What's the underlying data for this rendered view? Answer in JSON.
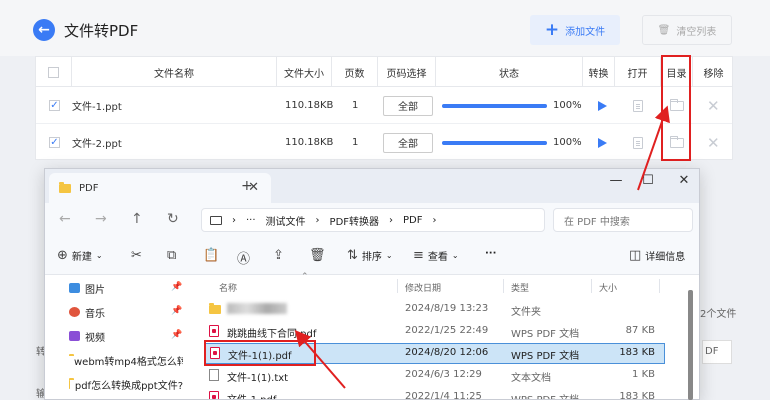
{
  "app": {
    "title": "文件转PDF",
    "add_file_label": "添加文件",
    "clear_label": "清空列表"
  },
  "table": {
    "headers": [
      "文件名称",
      "文件大小",
      "页数",
      "页码选择",
      "状态",
      "转换",
      "打开",
      "目录",
      "移除"
    ],
    "rows": [
      {
        "name": "文件-1.ppt",
        "size": "110.18KB",
        "pages": "1",
        "page_select": "全部",
        "progress": 1.0,
        "progress_label": "100%"
      },
      {
        "name": "文件-2.ppt",
        "size": "110.18KB",
        "pages": "1",
        "page_select": "全部",
        "progress": 1.0,
        "progress_label": "100%"
      }
    ]
  },
  "background_labels": {
    "left_1": "转",
    "left_2": "输",
    "right_1": "2个文件",
    "right_2": "DF"
  },
  "explorer": {
    "tab_title": "PDF",
    "breadcrumb": [
      "测试文件",
      "PDF转换器",
      "PDF"
    ],
    "breadcrumb_more": "···",
    "search_placeholder": "在 PDF 中搜索",
    "toolbar": {
      "new_label": "新建",
      "sort_label": "排序",
      "view_label": "查看",
      "more_label": "···",
      "details_label": "详细信息"
    },
    "nav_items": [
      {
        "label": "图片",
        "icon": "pictures-icon",
        "pinned": true
      },
      {
        "label": "音乐",
        "icon": "music-icon",
        "pinned": true
      },
      {
        "label": "视频",
        "icon": "video-icon",
        "pinned": true
      },
      {
        "label": "webm转mp4格式怎么转",
        "icon": "folder-icon",
        "pinned": false
      },
      {
        "label": "pdf怎么转换成ppt文件?",
        "icon": "folder-icon",
        "pinned": false
      }
    ],
    "columns": [
      "名称",
      "修改日期",
      "类型",
      "大小"
    ],
    "files": [
      {
        "name": "",
        "date": "2024/8/19 13:23",
        "type": "文件夹",
        "size": "",
        "icon": "folder-icon",
        "blurred": true
      },
      {
        "name": "跳跳曲线下合同.pdf",
        "date": "2022/1/25 22:49",
        "type": "WPS PDF 文档",
        "size": "87 KB",
        "icon": "pdf-icon"
      },
      {
        "name": "文件-1(1).pdf",
        "date": "2024/8/20 12:06",
        "type": "WPS PDF 文档",
        "size": "183 KB",
        "icon": "pdf-icon",
        "selected": true
      },
      {
        "name": "文件-1(1).txt",
        "date": "2024/6/3 12:29",
        "type": "文本文档",
        "size": "1 KB",
        "icon": "txt-icon"
      },
      {
        "name": "文件-1.pdf",
        "date": "2022/1/4 11:25",
        "type": "WPS PDF 文档",
        "size": "183 KB",
        "icon": "pdf-icon"
      }
    ]
  },
  "colors": {
    "accent": "#3a7bf5",
    "highlight_red": "#e02020",
    "selection": "#cce4f7"
  }
}
